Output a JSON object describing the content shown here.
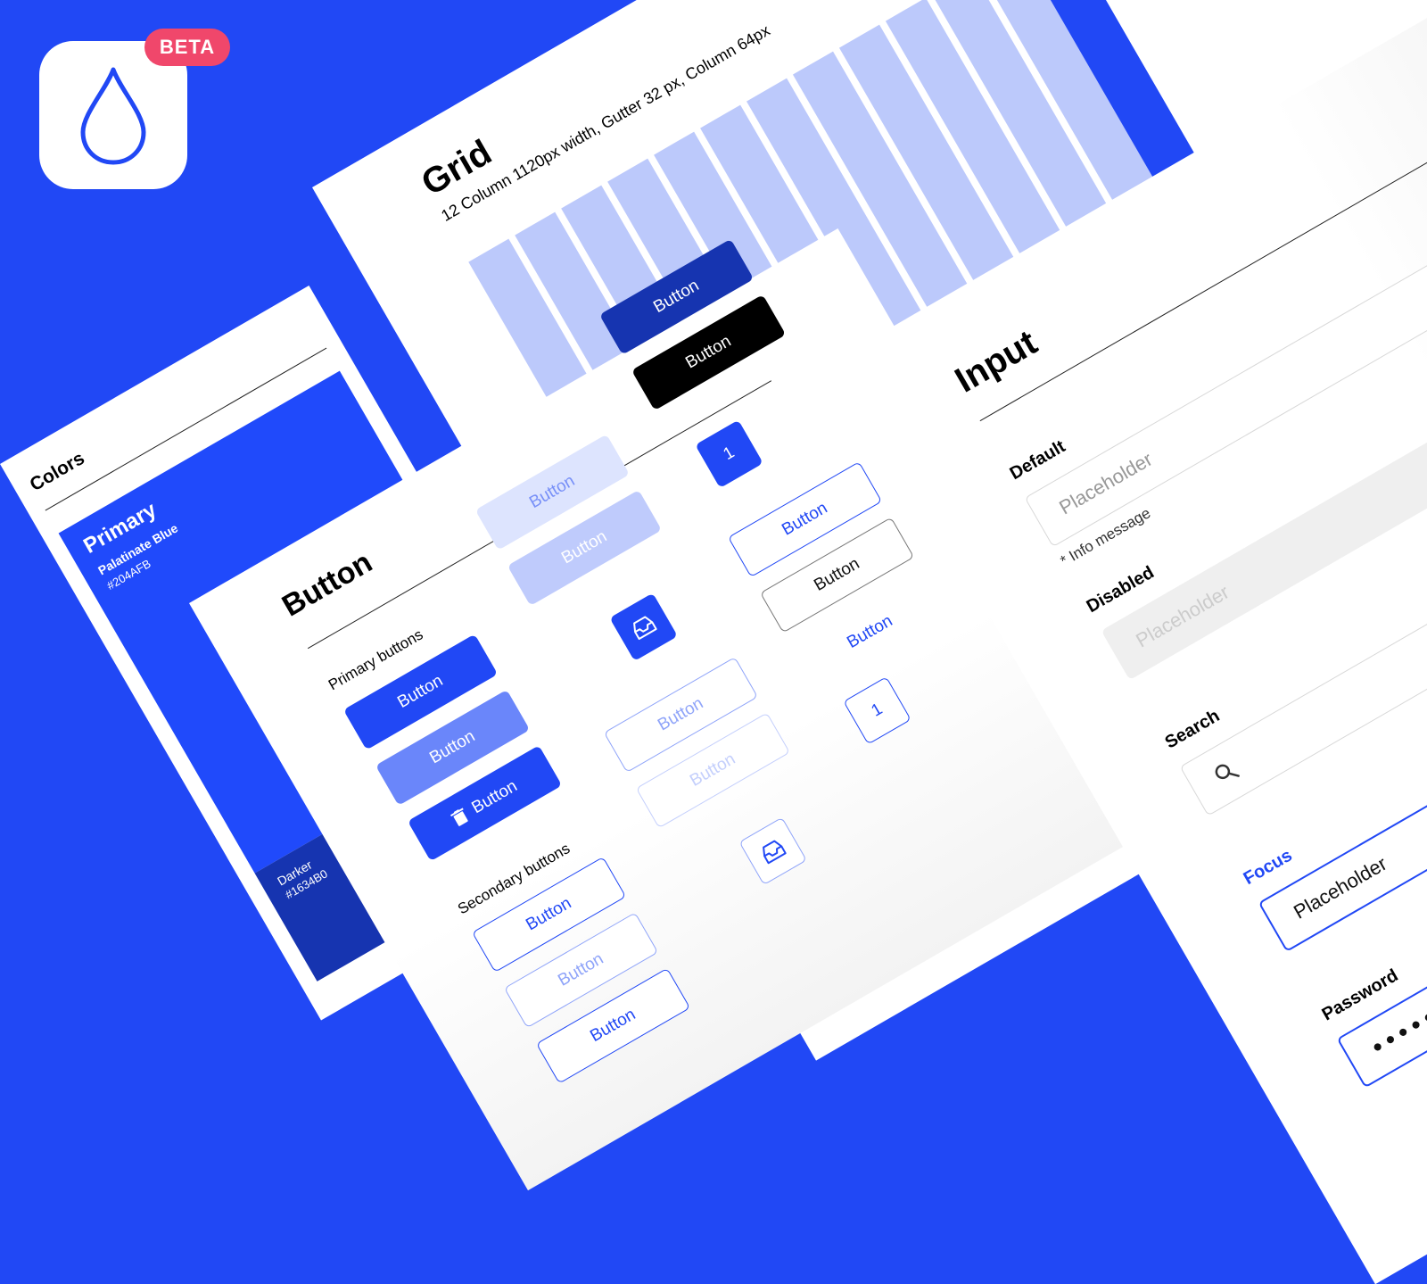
{
  "badge": {
    "label": "BETA"
  },
  "grid": {
    "title": "Grid",
    "subtitle": "12 Column 1120px width, Gutter 32 px, Column 64px",
    "columns": 12
  },
  "colors": {
    "title": "Colors",
    "primary_label": "Primary",
    "primary_name": "Palatinate Blue",
    "primary_hex": "#204AFB",
    "darker_label": "Darker",
    "darker_hex": "#1634B0"
  },
  "button": {
    "title": "Button",
    "primary_heading": "Primary buttons",
    "secondary_heading": "Secondary buttons",
    "label": "Button",
    "number": "1"
  },
  "input": {
    "title": "Input",
    "default_label": "Default",
    "placeholder": "Placeholder",
    "info_message": "* Info message",
    "disabled_label": "Disabled",
    "search_label": "Search",
    "focus_label": "Focus",
    "password_label": "Password",
    "password_value": "••••••"
  },
  "palette": {
    "background": "#2148F5",
    "primary": "#204AFB",
    "darker": "#1634B0",
    "badge": "#F0476B",
    "grid_column": "#BCC9FB"
  },
  "icons": [
    "drop-icon",
    "inbox-icon",
    "trash-icon",
    "search-icon"
  ]
}
